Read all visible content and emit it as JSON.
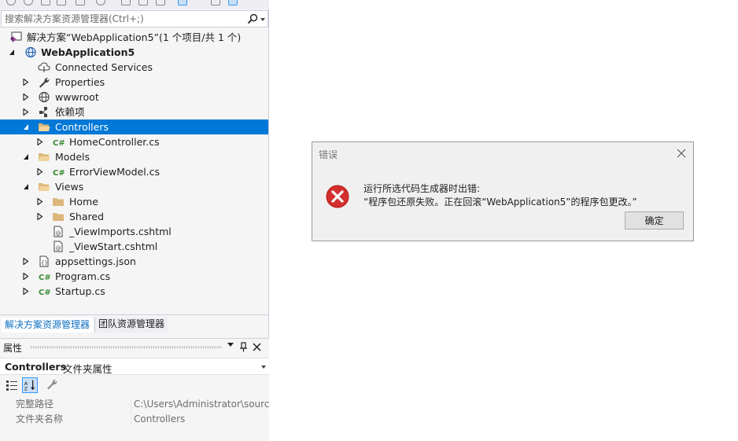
{
  "search": {
    "placeholder": "搜索解决方案资源管理器(Ctrl+;)"
  },
  "tree": {
    "solution": "解决方案“WebApplication5”(1 个项目/共 1 个)",
    "project": "WebApplication5",
    "items": [
      "Connected Services",
      "Properties",
      "wwwroot",
      "依赖项",
      "Controllers",
      "HomeController.cs",
      "Models",
      "ErrorViewModel.cs",
      "Views",
      "Home",
      "Shared",
      "_ViewImports.cshtml",
      "_ViewStart.cshtml",
      "appsettings.json",
      "Program.cs",
      "Startup.cs"
    ]
  },
  "tabs": {
    "solution_explorer": "解决方案资源管理器",
    "team_explorer": "团队资源管理器"
  },
  "properties": {
    "title": "属性",
    "pin": "📌",
    "close": "✕",
    "object_name": "Controllers",
    "object_type": "文件夹属性",
    "rows": [
      {
        "name": "完整路径",
        "value": "C:\\Users\\Administrator\\source"
      },
      {
        "name": "文件夹名称",
        "value": "Controllers"
      }
    ]
  },
  "dialog": {
    "title": "错误",
    "line1": "运行所选代码生成器时出错:",
    "line2": "“程序包还原失败。正在回滚“WebApplication5”的程序包更改。”",
    "ok": "确定"
  },
  "colors": {
    "selection": "#0078d7",
    "error_red": "#d32f2f",
    "folder": "#dcb67a",
    "csharp": "#388a34"
  }
}
